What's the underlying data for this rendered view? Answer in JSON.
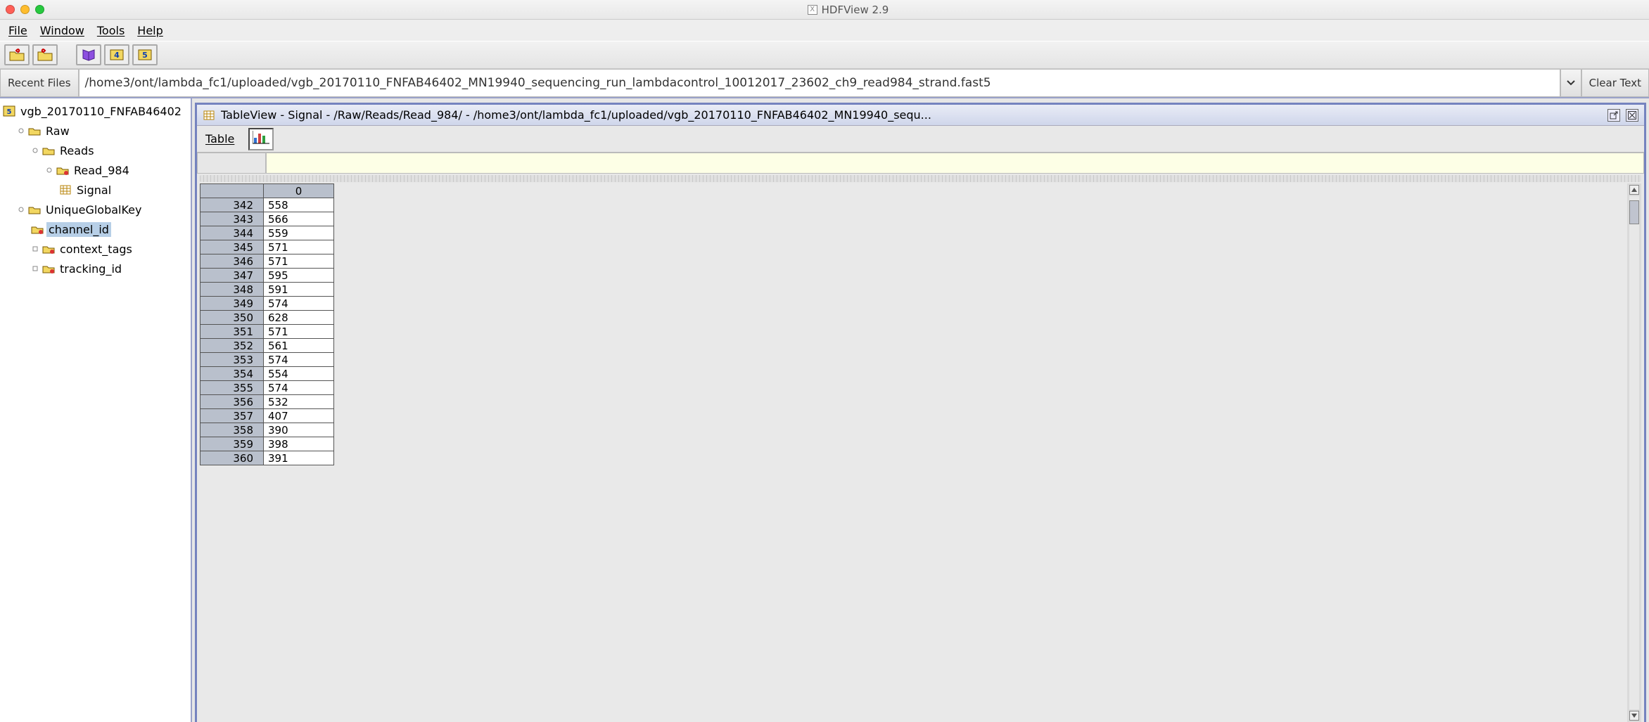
{
  "titlebar": {
    "app_title": "HDFView 2.9"
  },
  "menu": {
    "file": "File",
    "window": "Window",
    "tools": "Tools",
    "help": "Help"
  },
  "path_row": {
    "recent_label": "Recent Files",
    "path": "/home3/ont/lambda_fc1/uploaded/vgb_20170110_FNFAB46402_MN19940_sequencing_run_lambdacontrol_10012017_23602_ch9_read984_strand.fast5",
    "clear_label": "Clear Text"
  },
  "tree": {
    "root": "vgb_20170110_FNFAB46402",
    "raw": "Raw",
    "reads": "Reads",
    "read984": "Read_984",
    "signal": "Signal",
    "ugk": "UniqueGlobalKey",
    "channel_id": "channel_id",
    "context_tags": "context_tags",
    "tracking_id": "tracking_id"
  },
  "tableview": {
    "title": "TableView  -  Signal  -  /Raw/Reads/Read_984/  -  /home3/ont/lambda_fc1/uploaded/vgb_20170110_FNFAB46402_MN19940_sequ...",
    "table_menu": "Table",
    "col0": "0",
    "rows": [
      {
        "idx": "342",
        "val": "558"
      },
      {
        "idx": "343",
        "val": "566"
      },
      {
        "idx": "344",
        "val": "559"
      },
      {
        "idx": "345",
        "val": "571"
      },
      {
        "idx": "346",
        "val": "571"
      },
      {
        "idx": "347",
        "val": "595"
      },
      {
        "idx": "348",
        "val": "591"
      },
      {
        "idx": "349",
        "val": "574"
      },
      {
        "idx": "350",
        "val": "628"
      },
      {
        "idx": "351",
        "val": "571"
      },
      {
        "idx": "352",
        "val": "561"
      },
      {
        "idx": "353",
        "val": "574"
      },
      {
        "idx": "354",
        "val": "554"
      },
      {
        "idx": "355",
        "val": "574"
      },
      {
        "idx": "356",
        "val": "532"
      },
      {
        "idx": "357",
        "val": "407"
      },
      {
        "idx": "358",
        "val": "390"
      },
      {
        "idx": "359",
        "val": "398"
      },
      {
        "idx": "360",
        "val": "391"
      }
    ]
  }
}
